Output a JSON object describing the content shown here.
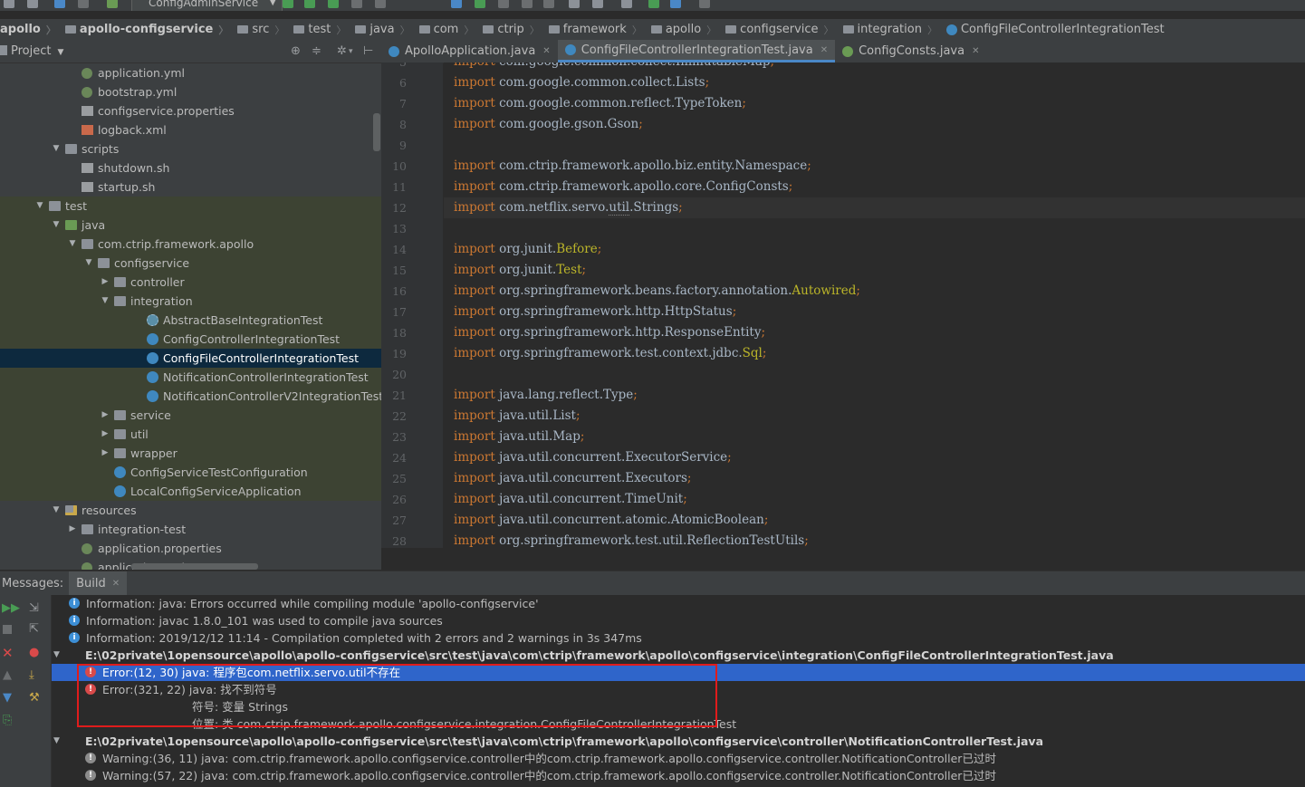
{
  "toolbar": {
    "run_config": "ConfigAdminService"
  },
  "breadcrumb": [
    {
      "label": "apollo",
      "bold": true,
      "icon": "none"
    },
    {
      "label": "apollo-configservice",
      "bold": true,
      "icon": "module-folder-icon"
    },
    {
      "label": "src",
      "bold": false,
      "icon": "folder-icon"
    },
    {
      "label": "test",
      "bold": false,
      "icon": "folder-icon"
    },
    {
      "label": "java",
      "bold": false,
      "icon": "folder-icon"
    },
    {
      "label": "com",
      "bold": false,
      "icon": "folder-icon"
    },
    {
      "label": "ctrip",
      "bold": false,
      "icon": "folder-icon"
    },
    {
      "label": "framework",
      "bold": false,
      "icon": "folder-icon"
    },
    {
      "label": "apollo",
      "bold": false,
      "icon": "folder-icon"
    },
    {
      "label": "configservice",
      "bold": false,
      "icon": "folder-icon"
    },
    {
      "label": "integration",
      "bold": false,
      "icon": "folder-icon"
    },
    {
      "label": "ConfigFileControllerIntegrationTest",
      "bold": false,
      "icon": "java-class-icon"
    }
  ],
  "project": {
    "title": "Project",
    "tree": [
      {
        "label": "application.yml",
        "icon": "yml-file-icon",
        "arrow": "",
        "level": 5,
        "tinted": false,
        "selected": false
      },
      {
        "label": "bootstrap.yml",
        "icon": "yml-file-icon",
        "arrow": "",
        "level": 5,
        "tinted": false,
        "selected": false
      },
      {
        "label": "configservice.properties",
        "icon": "properties-file-icon",
        "arrow": "",
        "level": 5,
        "tinted": false,
        "selected": false
      },
      {
        "label": "logback.xml",
        "icon": "xml-file-icon",
        "arrow": "",
        "level": 5,
        "tinted": false,
        "selected": false
      },
      {
        "label": "scripts",
        "icon": "folder-icon",
        "arrow": "down",
        "level": 4,
        "tinted": false,
        "selected": false
      },
      {
        "label": "shutdown.sh",
        "icon": "shell-file-icon",
        "arrow": "",
        "level": 5,
        "tinted": false,
        "selected": false
      },
      {
        "label": "startup.sh",
        "icon": "shell-file-icon",
        "arrow": "",
        "level": 5,
        "tinted": false,
        "selected": false
      },
      {
        "label": "test",
        "icon": "folder-icon",
        "arrow": "down",
        "level": 3,
        "tinted": true,
        "selected": false
      },
      {
        "label": "java",
        "icon": "test-source-folder-icon",
        "arrow": "down",
        "level": 4,
        "tinted": true,
        "selected": false
      },
      {
        "label": "com.ctrip.framework.apollo",
        "icon": "package-icon",
        "arrow": "down",
        "level": 5,
        "tinted": true,
        "selected": false
      },
      {
        "label": "configservice",
        "icon": "package-icon",
        "arrow": "down",
        "level": 6,
        "tinted": true,
        "selected": false
      },
      {
        "label": "controller",
        "icon": "package-icon",
        "arrow": "right",
        "level": 7,
        "tinted": true,
        "selected": false
      },
      {
        "label": "integration",
        "icon": "package-icon",
        "arrow": "down",
        "level": 7,
        "tinted": true,
        "selected": false
      },
      {
        "label": "AbstractBaseIntegrationTest",
        "icon": "abstract-class-icon",
        "arrow": "",
        "level": 9,
        "tinted": true,
        "selected": false
      },
      {
        "label": "ConfigControllerIntegrationTest",
        "icon": "java-class-icon",
        "arrow": "",
        "level": 9,
        "tinted": true,
        "selected": false
      },
      {
        "label": "ConfigFileControllerIntegrationTest",
        "icon": "java-class-icon",
        "arrow": "",
        "level": 9,
        "tinted": false,
        "selected": true
      },
      {
        "label": "NotificationControllerIntegrationTest",
        "icon": "java-class-icon",
        "arrow": "",
        "level": 9,
        "tinted": true,
        "selected": false
      },
      {
        "label": "NotificationControllerV2IntegrationTest",
        "icon": "java-class-icon",
        "arrow": "",
        "level": 9,
        "tinted": true,
        "selected": false
      },
      {
        "label": "service",
        "icon": "package-icon",
        "arrow": "right",
        "level": 7,
        "tinted": true,
        "selected": false
      },
      {
        "label": "util",
        "icon": "package-icon",
        "arrow": "right",
        "level": 7,
        "tinted": true,
        "selected": false
      },
      {
        "label": "wrapper",
        "icon": "package-icon",
        "arrow": "right",
        "level": 7,
        "tinted": true,
        "selected": false
      },
      {
        "label": "ConfigServiceTestConfiguration",
        "icon": "java-class-icon",
        "arrow": "",
        "level": 7,
        "tinted": true,
        "selected": false
      },
      {
        "label": "LocalConfigServiceApplication",
        "icon": "java-class-icon",
        "arrow": "",
        "level": 7,
        "tinted": true,
        "selected": false
      },
      {
        "label": "resources",
        "icon": "resources-folder-icon",
        "arrow": "down",
        "level": 4,
        "tinted": false,
        "selected": false
      },
      {
        "label": "integration-test",
        "icon": "folder-icon",
        "arrow": "right",
        "level": 5,
        "tinted": false,
        "selected": false
      },
      {
        "label": "application.properties",
        "icon": "yml-file-icon",
        "arrow": "",
        "level": 5,
        "tinted": false,
        "selected": false
      },
      {
        "label": "application.yml",
        "icon": "yml-file-icon",
        "arrow": "",
        "level": 5,
        "tinted": false,
        "selected": false
      }
    ]
  },
  "editor": {
    "tabs": [
      {
        "label": "ApolloApplication.java",
        "icon": "java-class-icon",
        "color": "#3f88bf",
        "active": false
      },
      {
        "label": "ConfigFileControllerIntegrationTest.java",
        "icon": "java-class-icon",
        "color": "#3f88bf",
        "active": true
      },
      {
        "label": "ConfigConsts.java",
        "icon": "interface-icon",
        "color": "#6a9b54",
        "active": false
      }
    ],
    "lines": [
      {
        "n": "5",
        "tokens": [
          {
            "t": "import",
            "c": "kw"
          },
          {
            "t": " com.google.common.collect.ImmutableMap",
            "c": ""
          },
          {
            "t": ";",
            "c": "pn"
          }
        ]
      },
      {
        "n": "6",
        "tokens": [
          {
            "t": "import",
            "c": "kw"
          },
          {
            "t": " com.google.common.collect.Lists",
            "c": ""
          },
          {
            "t": ";",
            "c": "pn"
          }
        ]
      },
      {
        "n": "7",
        "tokens": [
          {
            "t": "import",
            "c": "kw"
          },
          {
            "t": " com.google.common.reflect.TypeToken",
            "c": ""
          },
          {
            "t": ";",
            "c": "pn"
          }
        ]
      },
      {
        "n": "8",
        "tokens": [
          {
            "t": "import",
            "c": "kw"
          },
          {
            "t": " com.google.gson.Gson",
            "c": ""
          },
          {
            "t": ";",
            "c": "pn"
          }
        ]
      },
      {
        "n": "9",
        "tokens": []
      },
      {
        "n": "10",
        "tokens": [
          {
            "t": "import",
            "c": "kw"
          },
          {
            "t": " com.ctrip.framework.apollo.biz.entity.Namespace",
            "c": ""
          },
          {
            "t": ";",
            "c": "pn"
          }
        ]
      },
      {
        "n": "11",
        "tokens": [
          {
            "t": "import",
            "c": "kw"
          },
          {
            "t": " com.ctrip.framework.apollo.core.ConfigConsts",
            "c": ""
          },
          {
            "t": ";",
            "c": "pn"
          }
        ]
      },
      {
        "n": "12",
        "caret": true,
        "tokens": [
          {
            "t": "import",
            "c": "kw"
          },
          {
            "t": " com.netflix.servo.",
            "c": ""
          },
          {
            "t": "util",
            "c": "ul"
          },
          {
            "t": ".Strings",
            "c": ""
          },
          {
            "t": ";",
            "c": "pn"
          }
        ]
      },
      {
        "n": "13",
        "tokens": []
      },
      {
        "n": "14",
        "tokens": [
          {
            "t": "import",
            "c": "kw"
          },
          {
            "t": " org.junit.",
            "c": ""
          },
          {
            "t": "Before",
            "c": "anno"
          },
          {
            "t": ";",
            "c": "pn"
          }
        ]
      },
      {
        "n": "15",
        "tokens": [
          {
            "t": "import",
            "c": "kw"
          },
          {
            "t": " org.junit.",
            "c": ""
          },
          {
            "t": "Test",
            "c": "anno"
          },
          {
            "t": ";",
            "c": "pn"
          }
        ]
      },
      {
        "n": "16",
        "tokens": [
          {
            "t": "import",
            "c": "kw"
          },
          {
            "t": " org.springframework.beans.factory.annotation.",
            "c": ""
          },
          {
            "t": "Autowired",
            "c": "anno"
          },
          {
            "t": ";",
            "c": "pn"
          }
        ]
      },
      {
        "n": "17",
        "tokens": [
          {
            "t": "import",
            "c": "kw"
          },
          {
            "t": " org.springframework.http.HttpStatus",
            "c": ""
          },
          {
            "t": ";",
            "c": "pn"
          }
        ]
      },
      {
        "n": "18",
        "tokens": [
          {
            "t": "import",
            "c": "kw"
          },
          {
            "t": " org.springframework.http.ResponseEntity",
            "c": ""
          },
          {
            "t": ";",
            "c": "pn"
          }
        ]
      },
      {
        "n": "19",
        "tokens": [
          {
            "t": "import",
            "c": "kw"
          },
          {
            "t": " org.springframework.test.context.jdbc.",
            "c": ""
          },
          {
            "t": "Sql",
            "c": "anno"
          },
          {
            "t": ";",
            "c": "pn"
          }
        ]
      },
      {
        "n": "20",
        "tokens": []
      },
      {
        "n": "21",
        "tokens": [
          {
            "t": "import",
            "c": "kw"
          },
          {
            "t": " java.lang.reflect.Type",
            "c": ""
          },
          {
            "t": ";",
            "c": "pn"
          }
        ]
      },
      {
        "n": "22",
        "tokens": [
          {
            "t": "import",
            "c": "kw"
          },
          {
            "t": " java.util.List",
            "c": ""
          },
          {
            "t": ";",
            "c": "pn"
          }
        ]
      },
      {
        "n": "23",
        "tokens": [
          {
            "t": "import",
            "c": "kw"
          },
          {
            "t": " java.util.Map",
            "c": ""
          },
          {
            "t": ";",
            "c": "pn"
          }
        ]
      },
      {
        "n": "24",
        "tokens": [
          {
            "t": "import",
            "c": "kw"
          },
          {
            "t": " java.util.concurrent.ExecutorService",
            "c": ""
          },
          {
            "t": ";",
            "c": "pn"
          }
        ]
      },
      {
        "n": "25",
        "tokens": [
          {
            "t": "import",
            "c": "kw"
          },
          {
            "t": " java.util.concurrent.Executors",
            "c": ""
          },
          {
            "t": ";",
            "c": "pn"
          }
        ]
      },
      {
        "n": "26",
        "tokens": [
          {
            "t": "import",
            "c": "kw"
          },
          {
            "t": " java.util.concurrent.TimeUnit",
            "c": ""
          },
          {
            "t": ";",
            "c": "pn"
          }
        ]
      },
      {
        "n": "27",
        "tokens": [
          {
            "t": "import",
            "c": "kw"
          },
          {
            "t": " java.util.concurrent.atomic.AtomicBoolean",
            "c": ""
          },
          {
            "t": ";",
            "c": "pn"
          }
        ]
      },
      {
        "n": "28",
        "tokens": [
          {
            "t": "import",
            "c": "kw"
          },
          {
            "t": " org.springframework.test.util.ReflectionTestUtils",
            "c": ""
          },
          {
            "t": ";",
            "c": "pn"
          }
        ]
      }
    ]
  },
  "messages": {
    "title": "Messages:",
    "tab": "Build",
    "rows": [
      {
        "type": "info",
        "indent": 1,
        "arrow": "",
        "text": "Information: java: Errors occurred while compiling module 'apollo-configservice'",
        "selected": false
      },
      {
        "type": "info",
        "indent": 1,
        "arrow": "",
        "text": "Information: javac 1.8.0_101 was used to compile java sources",
        "selected": false
      },
      {
        "type": "info",
        "indent": 1,
        "arrow": "",
        "text": "Information: 2019/12/12 11:14 - Compilation completed with 2 errors and 2 warnings in 3s 347ms",
        "selected": false
      },
      {
        "type": "file",
        "indent": 0,
        "arrow": "down",
        "text": "E:\\02private\\1opensource\\apollo\\apollo-configservice\\src\\test\\java\\com\\ctrip\\framework\\apollo\\configservice\\integration\\ConfigFileControllerIntegrationTest.java",
        "selected": false
      },
      {
        "type": "err",
        "indent": 2,
        "arrow": "",
        "text": "Error:(12, 30)  java: 程序包com.netflix.servo.util不存在",
        "selected": true
      },
      {
        "type": "err",
        "indent": 2,
        "arrow": "",
        "text": "Error:(321, 22)  java: 找不到符号",
        "selected": false
      },
      {
        "type": "none",
        "indent": 3,
        "arrow": "",
        "text": "符号:   变量 Strings",
        "selected": false
      },
      {
        "type": "none",
        "indent": 3,
        "arrow": "",
        "text": "位置: 类 com.ctrip.framework.apollo.configservice.integration.ConfigFileControllerIntegrationTest",
        "selected": false
      },
      {
        "type": "file",
        "indent": 0,
        "arrow": "down",
        "text": "E:\\02private\\1opensource\\apollo\\apollo-configservice\\src\\test\\java\\com\\ctrip\\framework\\apollo\\configservice\\controller\\NotificationControllerTest.java",
        "selected": false
      },
      {
        "type": "warn",
        "indent": 2,
        "arrow": "",
        "text": "Warning:(36, 11)  java: com.ctrip.framework.apollo.configservice.controller中的com.ctrip.framework.apollo.configservice.controller.NotificationController已过时",
        "selected": false
      },
      {
        "type": "warn",
        "indent": 2,
        "arrow": "",
        "text": "Warning:(57, 22)  java: com.ctrip.framework.apollo.configservice.controller中的com.ctrip.framework.apollo.configservice.controller.NotificationController已过时",
        "selected": false
      }
    ]
  },
  "colors": {
    "selection_blue": "#2f65ca",
    "highlight_box_red": "#e01c1c",
    "keyword_orange": "#cc7832",
    "annotation_yellow": "#bbb529"
  }
}
